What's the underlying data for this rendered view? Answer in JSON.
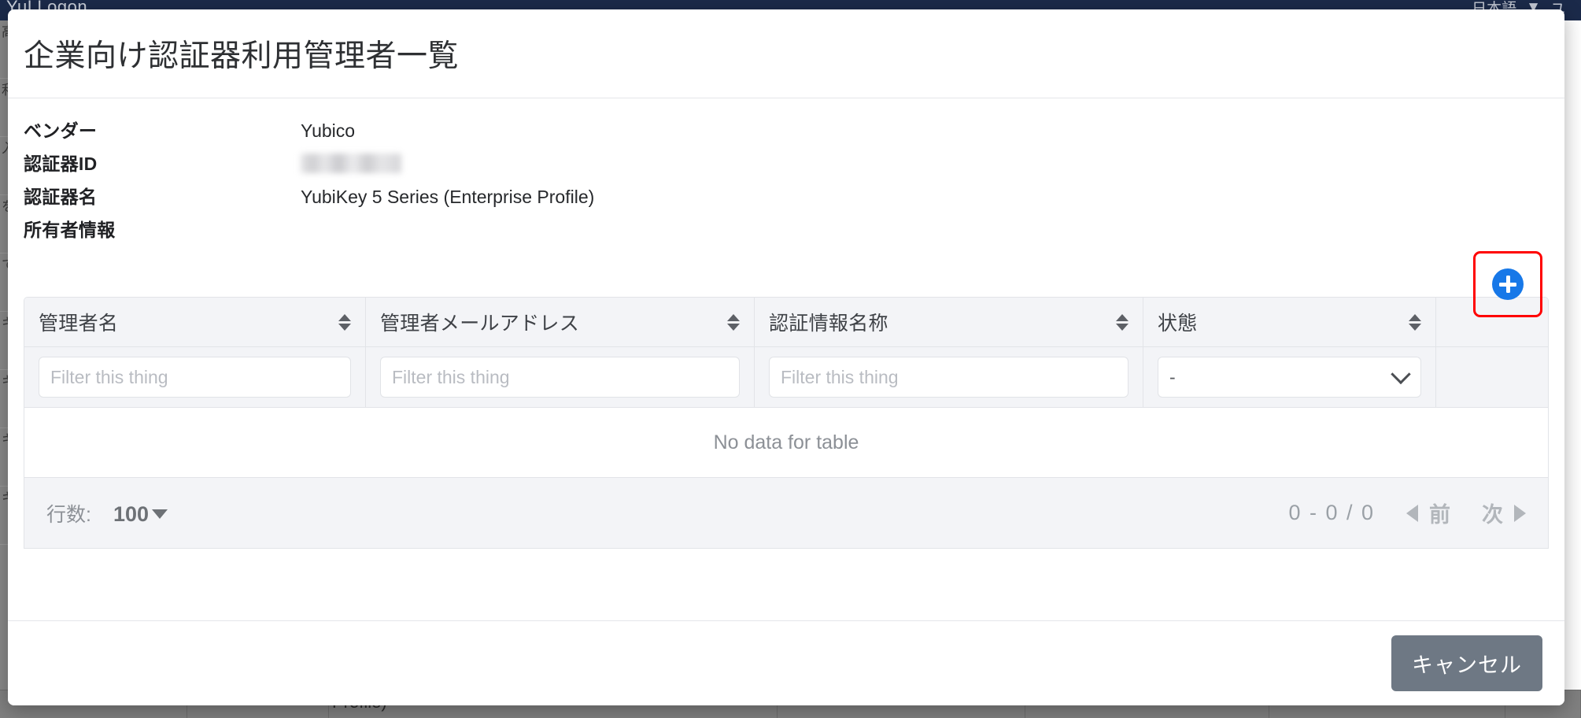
{
  "background": {
    "brand": "YuLLogon",
    "topbar_right_items": [
      "日本語",
      "▼",
      "ユ"
    ],
    "left_rail_cells": [
      "高",
      "利",
      "入",
      "を",
      "て",
      "キ",
      "キ",
      "キ",
      "キ"
    ],
    "bottom_row_cells": [
      "",
      "",
      "Profile)",
      "",
      "",
      "",
      ""
    ]
  },
  "modal": {
    "title": "企業向け認証器利用管理者一覧",
    "info": [
      {
        "label": "ベンダー",
        "value": "Yubico",
        "redacted": false
      },
      {
        "label": "認証器ID",
        "value": "",
        "redacted": true
      },
      {
        "label": "認証器名",
        "value": "YubiKey 5 Series (Enterprise Profile)",
        "redacted": false
      },
      {
        "label": "所有者情報",
        "value": "",
        "redacted": false
      }
    ],
    "add_button": {
      "icon": "plus-circle-icon",
      "color": "#1778e8",
      "highlight_color": "#ff0000"
    },
    "table": {
      "columns": [
        {
          "label": "管理者名",
          "sortable": true,
          "filter_type": "text"
        },
        {
          "label": "管理者メールアドレス",
          "sortable": true,
          "filter_type": "text"
        },
        {
          "label": "認証情報名称",
          "sortable": true,
          "filter_type": "text"
        },
        {
          "label": "状態",
          "sortable": true,
          "filter_type": "select"
        }
      ],
      "filter_placeholder": "Filter this thing",
      "status_filter_value": "-",
      "rows": [],
      "empty_message": "No data for table"
    },
    "pagination": {
      "rows_label": "行数:",
      "rows_per_page": "100",
      "range_text": "0 - 0 / 0",
      "prev_label": "前",
      "next_label": "次"
    },
    "footer": {
      "cancel_label": "キャンセル"
    }
  }
}
